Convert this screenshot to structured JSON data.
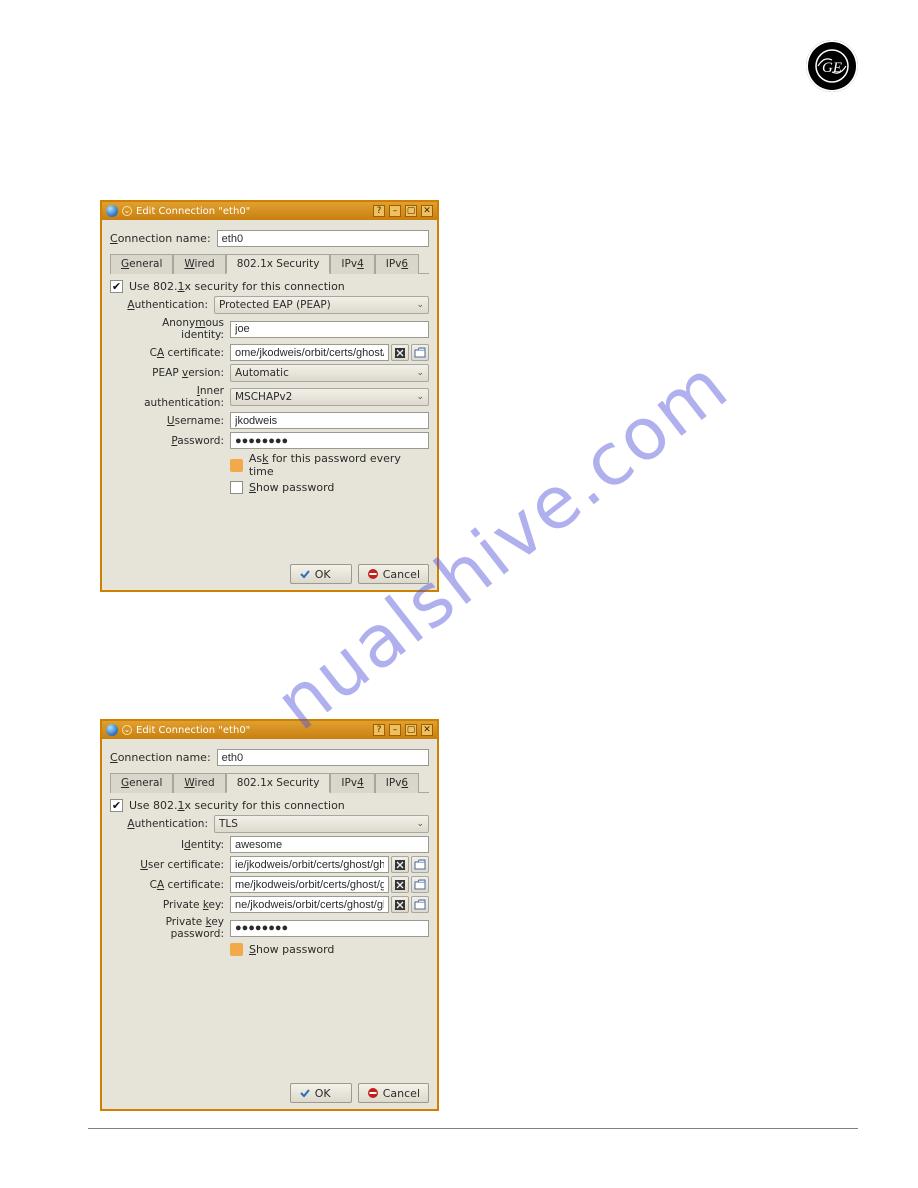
{
  "watermark": "nualshive.com",
  "dialog1": {
    "title": "Edit Connection \"eth0\"",
    "connection_name_label": "Connection name:",
    "connection_name": "eth0",
    "tabs": {
      "general": "General",
      "wired": "Wired",
      "security": "802.1x Security",
      "ipv4": "IPv4",
      "ipv6": "IPv6"
    },
    "use_security_label": "Use 802.1x security for this connection",
    "use_security_checked": true,
    "auth_label": "Authentication:",
    "auth_value": "Protected EAP (PEAP)",
    "anon_id_label": "Anonymous identity:",
    "anon_id": "joe",
    "ca_label": "CA certificate:",
    "ca_value": "ome/jkodweis/orbit/certs/ghost/ghost.ca.pem",
    "peap_label": "PEAP version:",
    "peap_value": "Automatic",
    "inner_label": "Inner authentication:",
    "inner_value": "MSCHAPv2",
    "user_label": "Username:",
    "user_value": "jkodweis",
    "pw_label": "Password:",
    "pw_value": "●●●●●●●●",
    "ask_label": "Ask for this password every time",
    "show_label": "Show password",
    "ok_label": "OK",
    "cancel_label": "Cancel"
  },
  "dialog2": {
    "title": "Edit Connection \"eth0\"",
    "connection_name_label": "Connection name:",
    "connection_name": "eth0",
    "tabs": {
      "general": "General",
      "wired": "Wired",
      "security": "802.1x Security",
      "ipv4": "IPv4",
      "ipv6": "IPv6"
    },
    "use_security_label": "Use 802.1x security for this connection",
    "use_security_checked": true,
    "auth_label": "Authentication:",
    "auth_value": "TLS",
    "identity_label": "Identity:",
    "identity_value": "awesome",
    "usercert_label": "User certificate:",
    "usercert_value": "ie/jkodweis/orbit/certs/ghost/ghost.cert.pem",
    "ca_label": "CA certificate:",
    "ca_value": "me/jkodweis/orbit/certs/ghost/ghost.ca.pem",
    "pk_label": "Private key:",
    "pk_value": "ne/jkodweis/orbit/certs/ghost/ghost.key.pem",
    "pkpw_label": "Private key password:",
    "pkpw_value": "●●●●●●●●",
    "show_label": "Show password",
    "ok_label": "OK",
    "cancel_label": "Cancel"
  }
}
